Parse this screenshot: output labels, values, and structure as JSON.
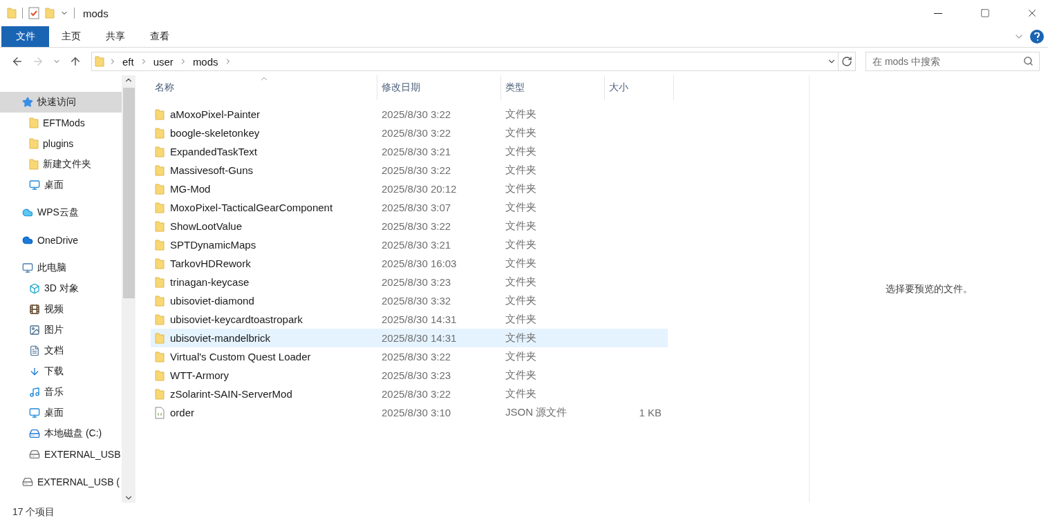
{
  "window": {
    "title": "mods"
  },
  "ribbon": {
    "tabs": [
      {
        "label": "文件",
        "kind": "file_menu"
      },
      {
        "label": "主页",
        "kind": "tab"
      },
      {
        "label": "共享",
        "kind": "tab"
      },
      {
        "label": "查看",
        "kind": "tab"
      }
    ]
  },
  "address_bar": {
    "path": [
      "eft",
      "user",
      "mods"
    ]
  },
  "search": {
    "placeholder": "在 mods 中搜索"
  },
  "sidebar": {
    "items": [
      {
        "label": "快速访问",
        "kind": "star",
        "selected": true,
        "children": [
          {
            "label": "EFTMods",
            "kind": "folder",
            "selected": false
          },
          {
            "label": "plugins",
            "kind": "folder",
            "selected": false
          },
          {
            "label": "新建文件夹",
            "kind": "folder",
            "selected": false
          },
          {
            "label": "桌面",
            "kind": "desktop",
            "selected": false
          }
        ]
      },
      {
        "label": "WPS云盘",
        "kind": "cloud",
        "selected": false
      },
      {
        "label": "OneDrive",
        "kind": "onedrive",
        "selected": false
      },
      {
        "label": "此电脑",
        "kind": "pc",
        "selected": false,
        "children": [
          {
            "label": "3D 对象",
            "kind": "cube",
            "selected": false
          },
          {
            "label": "视频",
            "kind": "video",
            "selected": false
          },
          {
            "label": "图片",
            "kind": "picture",
            "selected": false
          },
          {
            "label": "文档",
            "kind": "document",
            "selected": false
          },
          {
            "label": "下载",
            "kind": "download",
            "selected": false
          },
          {
            "label": "音乐",
            "kind": "music",
            "selected": false
          },
          {
            "label": "桌面",
            "kind": "desktop",
            "selected": false
          },
          {
            "label": "本地磁盘 (C:)",
            "kind": "system_drive",
            "selected": false
          },
          {
            "label": "EXTERNAL_USB",
            "kind": "drive",
            "selected": false
          }
        ]
      },
      {
        "label": "EXTERNAL_USB (",
        "kind": "drive",
        "selected": false
      }
    ]
  },
  "file_list": {
    "columns": [
      {
        "label": "名称",
        "sorted": true
      },
      {
        "label": "修改日期",
        "sorted": false
      },
      {
        "label": "类型",
        "sorted": false
      },
      {
        "label": "大小",
        "sorted": false
      }
    ],
    "rows": [
      {
        "name": "aMoxoPixel-Painter",
        "date": "2025/8/30 3:22",
        "type": "文件夹",
        "kind": "folder",
        "selected": false
      },
      {
        "name": "boogle-skeletonkey",
        "date": "2025/8/30 3:22",
        "type": "文件夹",
        "kind": "folder",
        "selected": false
      },
      {
        "name": "ExpandedTaskText",
        "date": "2025/8/30 3:21",
        "type": "文件夹",
        "kind": "folder",
        "selected": false
      },
      {
        "name": "Massivesoft-Guns",
        "date": "2025/8/30 3:22",
        "type": "文件夹",
        "kind": "folder",
        "selected": false
      },
      {
        "name": "MG-Mod",
        "date": "2025/8/30 20:12",
        "type": "文件夹",
        "kind": "folder",
        "selected": false
      },
      {
        "name": "MoxoPixel-TacticalGearComponent",
        "date": "2025/8/30 3:07",
        "type": "文件夹",
        "kind": "folder",
        "selected": false
      },
      {
        "name": "ShowLootValue",
        "date": "2025/8/30 3:22",
        "type": "文件夹",
        "kind": "folder",
        "selected": false
      },
      {
        "name": "SPTDynamicMaps",
        "date": "2025/8/30 3:21",
        "type": "文件夹",
        "kind": "folder",
        "selected": false
      },
      {
        "name": "TarkovHDRework",
        "date": "2025/8/30 16:03",
        "type": "文件夹",
        "kind": "folder",
        "selected": false
      },
      {
        "name": "trinagan-keycase",
        "date": "2025/8/30 3:23",
        "type": "文件夹",
        "kind": "folder",
        "selected": false
      },
      {
        "name": "ubisoviet-diamond",
        "date": "2025/8/30 3:32",
        "type": "文件夹",
        "kind": "folder",
        "selected": false
      },
      {
        "name": "ubisoviet-keycardtoastropark",
        "date": "2025/8/30 14:31",
        "type": "文件夹",
        "kind": "folder",
        "selected": false
      },
      {
        "name": "ubisoviet-mandelbrick",
        "date": "2025/8/30 14:31",
        "type": "文件夹",
        "kind": "folder",
        "selected": true
      },
      {
        "name": "Virtual's Custom Quest Loader",
        "date": "2025/8/30 3:22",
        "type": "文件夹",
        "kind": "folder",
        "selected": false
      },
      {
        "name": "WTT-Armory",
        "date": "2025/8/30 3:23",
        "type": "文件夹",
        "kind": "folder",
        "selected": false
      },
      {
        "name": "zSolarint-SAIN-ServerMod",
        "date": "2025/8/30 3:22",
        "type": "文件夹",
        "kind": "folder",
        "selected": false
      },
      {
        "name": "order",
        "date": "2025/8/30 3:10",
        "type": "JSON 源文件",
        "size": "1 KB",
        "kind": "file",
        "selected": false
      }
    ]
  },
  "preview_pane": {
    "message": "选择要预览的文件。"
  },
  "status_bar": {
    "item_count": "17 个项目"
  }
}
